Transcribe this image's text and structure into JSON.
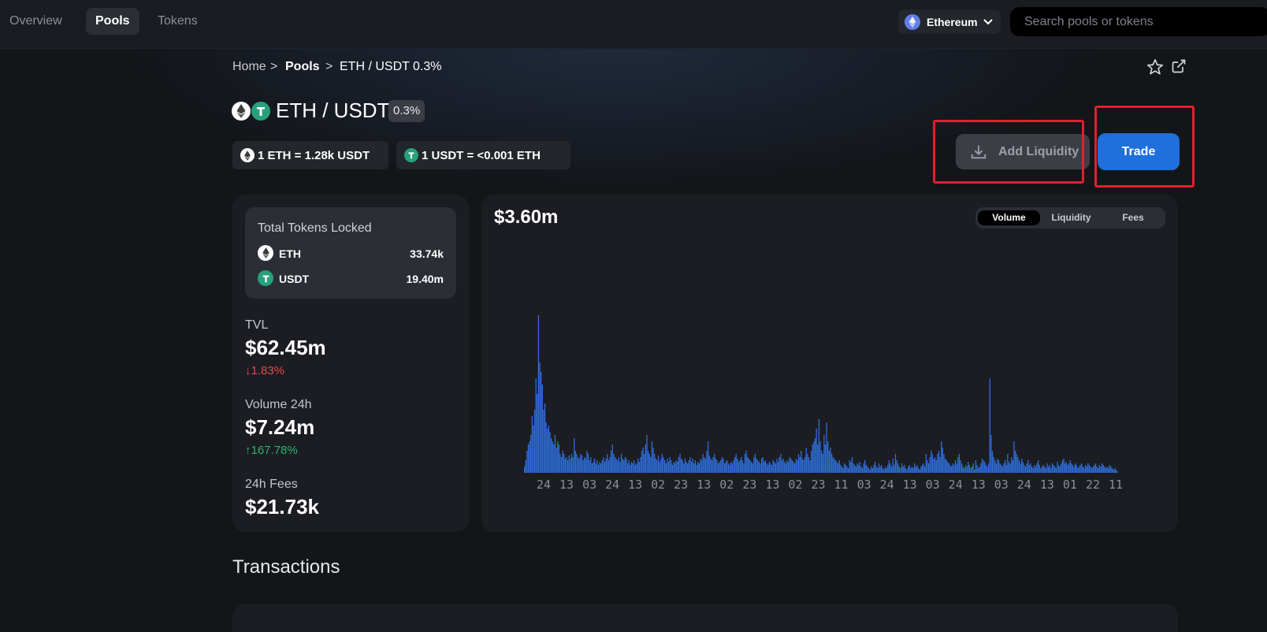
{
  "nav": {
    "items": [
      "Overview",
      "Pools",
      "Tokens"
    ],
    "active": "Pools",
    "network": "Ethereum",
    "search_placeholder": "Search pools or tokens"
  },
  "breadcrumb": {
    "home": "Home",
    "pools": "Pools",
    "current": "ETH / USDT 0.3%"
  },
  "pool": {
    "name": "ETH / USDT",
    "fee_tier": "0.3%",
    "price_eth": "1 ETH = 1.28k USDT",
    "price_usdt": "1 USDT = <0.001 ETH"
  },
  "actions": {
    "add_liquidity": "Add Liquidity",
    "trade": "Trade"
  },
  "stats": {
    "total_tokens_locked_label": "Total Tokens Locked",
    "tokens": [
      {
        "symbol": "ETH",
        "amount": "33.74k"
      },
      {
        "symbol": "USDT",
        "amount": "19.40m"
      }
    ],
    "tvl_label": "TVL",
    "tvl_value": "$62.45m",
    "tvl_change": "↓1.83%",
    "volume_label": "Volume 24h",
    "volume_value": "$7.24m",
    "volume_change": "↑167.78%",
    "fees_label": "24h Fees",
    "fees_value": "$21.73k"
  },
  "chart_toggle": {
    "options": [
      "Volume",
      "Liquidity",
      "Fees"
    ],
    "active": "Volume"
  },
  "chart_data": {
    "type": "bar",
    "headline": "$3.60m",
    "x_tick_labels": [
      "24",
      "13",
      "03",
      "24",
      "13",
      "02",
      "23",
      "13",
      "02",
      "23",
      "13",
      "02",
      "23",
      "11",
      "03",
      "24",
      "13",
      "03",
      "24",
      "13",
      "03",
      "24",
      "13",
      "01",
      "22",
      "11"
    ],
    "values": [
      4,
      8,
      14,
      18,
      20,
      24,
      36,
      30,
      40,
      60,
      50,
      100,
      70,
      64,
      56,
      40,
      44,
      32,
      28,
      30,
      26,
      22,
      20,
      18,
      24,
      16,
      20,
      18,
      12,
      10,
      14,
      12,
      9,
      10,
      8,
      11,
      9,
      12,
      10,
      22,
      14,
      12,
      10,
      9,
      12,
      11,
      8,
      10,
      9,
      14,
      12,
      8,
      10,
      6,
      7,
      9,
      6,
      8,
      5,
      7,
      6,
      8,
      10,
      7,
      9,
      12,
      8,
      10,
      14,
      18,
      12,
      10,
      9,
      8,
      10,
      7,
      12,
      9,
      8,
      10,
      9,
      6,
      8,
      5,
      7,
      6,
      8,
      5,
      6,
      9,
      7,
      10,
      14,
      16,
      12,
      18,
      24,
      14,
      12,
      10,
      20,
      16,
      12,
      9,
      8,
      11,
      7,
      9,
      12,
      10,
      8,
      6,
      9,
      7,
      10,
      8,
      5,
      7,
      6,
      8,
      7,
      10,
      12,
      9,
      8,
      6,
      9,
      7,
      6,
      8,
      10,
      7,
      9,
      6,
      8,
      5,
      7,
      6,
      9,
      8,
      12,
      10,
      9,
      14,
      20,
      11,
      9,
      8,
      10,
      12,
      9,
      8,
      6,
      7,
      8,
      10,
      9,
      6,
      7,
      8,
      6,
      5,
      7,
      6,
      8,
      10,
      12,
      9,
      7,
      8,
      10,
      8,
      6,
      12,
      14,
      10,
      9,
      8,
      7,
      6,
      10,
      12,
      9,
      8,
      7,
      6,
      9,
      10,
      7,
      8,
      6,
      5,
      7,
      6,
      5,
      8,
      7,
      6,
      9,
      7,
      10,
      12,
      8,
      9,
      7,
      6,
      8,
      7,
      10,
      9,
      8,
      7,
      6,
      9,
      8,
      12,
      10,
      14,
      9,
      8,
      10,
      16,
      12,
      10,
      8,
      14,
      18,
      20,
      22,
      28,
      18,
      34,
      20,
      14,
      12,
      24,
      18,
      32,
      20,
      14,
      16,
      12,
      10,
      9,
      8,
      7,
      6,
      8,
      5,
      4,
      3,
      6,
      5,
      4,
      3,
      8,
      7,
      10,
      6,
      5,
      4,
      6,
      5,
      7,
      4,
      3,
      6,
      8,
      5,
      4,
      3,
      2,
      4,
      3,
      5,
      7,
      4,
      3,
      6,
      4,
      5,
      3,
      2,
      4,
      3,
      5,
      8,
      6,
      4,
      9,
      5,
      12,
      8,
      6,
      4,
      3,
      6,
      4,
      5,
      3,
      2,
      4,
      5,
      3,
      4,
      3,
      6,
      4,
      5,
      3,
      2,
      4,
      5,
      6,
      4,
      12,
      8,
      6,
      10,
      14,
      12,
      9,
      10,
      8,
      12,
      14,
      10,
      20,
      16,
      12,
      9,
      8,
      7,
      6,
      5,
      4,
      6,
      5,
      8,
      6,
      10,
      12,
      8,
      6,
      4,
      3,
      5,
      4,
      7,
      5,
      3,
      4,
      6,
      2,
      8,
      5,
      3,
      4,
      6,
      9,
      8,
      7,
      5,
      4,
      6,
      60,
      24,
      14,
      10,
      8,
      6,
      9,
      8,
      6,
      5,
      4,
      6,
      8,
      5,
      12,
      7,
      6,
      10,
      8,
      20,
      14,
      12,
      10,
      8,
      6,
      9,
      7,
      5,
      4,
      6,
      8,
      5,
      6,
      4,
      3,
      5,
      4,
      6,
      8,
      5,
      3,
      4,
      5,
      4,
      3,
      6,
      4,
      5,
      3,
      6,
      5,
      4,
      3,
      7,
      5,
      4,
      6,
      8,
      9,
      6,
      7,
      5,
      6,
      8,
      6,
      5,
      4,
      6,
      5,
      3,
      4,
      5,
      6,
      4,
      3,
      5,
      4,
      6,
      5,
      4,
      3,
      4,
      5,
      6,
      4,
      3,
      5,
      4,
      6,
      5,
      4,
      3,
      4,
      3,
      5,
      4,
      3,
      2,
      3,
      2,
      1
    ]
  },
  "transactions": {
    "title": "Transactions"
  },
  "colors": {
    "accent": "#1f6fdc",
    "bar": "#2f6fdc",
    "positive": "#2fb36c",
    "negative": "#e5484d",
    "highlight_box": "#e0202e"
  }
}
